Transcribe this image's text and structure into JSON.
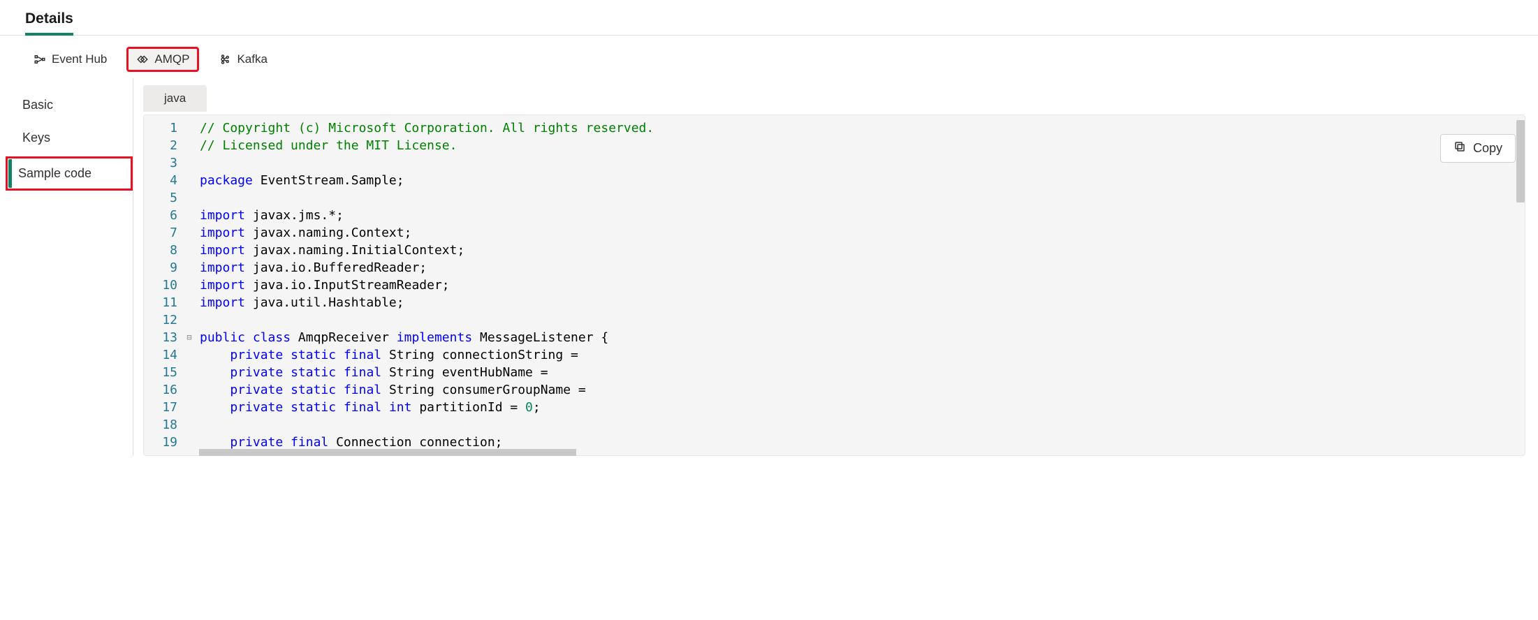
{
  "header": {
    "title": "Details"
  },
  "protocol_tabs": [
    {
      "id": "eventhub",
      "label": "Event Hub",
      "selected": false,
      "highlighted": false
    },
    {
      "id": "amqp",
      "label": "AMQP",
      "selected": true,
      "highlighted": true
    },
    {
      "id": "kafka",
      "label": "Kafka",
      "selected": false,
      "highlighted": false
    }
  ],
  "sidebar": {
    "items": [
      {
        "id": "basic",
        "label": "Basic",
        "active": false,
        "highlighted": false
      },
      {
        "id": "keys",
        "label": "Keys",
        "active": false,
        "highlighted": false
      },
      {
        "id": "sample",
        "label": "Sample code",
        "active": true,
        "highlighted": true
      }
    ]
  },
  "lang_tab": {
    "label": "java"
  },
  "copy_button": {
    "label": "Copy"
  },
  "code": {
    "lines": [
      {
        "n": 1,
        "fold": "",
        "tokens": [
          {
            "t": "// Copyright (c) Microsoft Corporation. All rights reserved.",
            "c": "comment"
          }
        ]
      },
      {
        "n": 2,
        "fold": "",
        "tokens": [
          {
            "t": "// Licensed under the MIT License.",
            "c": "comment"
          }
        ]
      },
      {
        "n": 3,
        "fold": "",
        "tokens": [
          {
            "t": "",
            "c": "ident"
          }
        ]
      },
      {
        "n": 4,
        "fold": "",
        "tokens": [
          {
            "t": "package",
            "c": "keyword"
          },
          {
            "t": " EventStream.Sample;",
            "c": "ident"
          }
        ]
      },
      {
        "n": 5,
        "fold": "",
        "tokens": [
          {
            "t": "",
            "c": "ident"
          }
        ]
      },
      {
        "n": 6,
        "fold": "",
        "tokens": [
          {
            "t": "import",
            "c": "keyword"
          },
          {
            "t": " javax.jms.*;",
            "c": "ident"
          }
        ]
      },
      {
        "n": 7,
        "fold": "",
        "tokens": [
          {
            "t": "import",
            "c": "keyword"
          },
          {
            "t": " javax.naming.Context;",
            "c": "ident"
          }
        ]
      },
      {
        "n": 8,
        "fold": "",
        "tokens": [
          {
            "t": "import",
            "c": "keyword"
          },
          {
            "t": " javax.naming.InitialContext;",
            "c": "ident"
          }
        ]
      },
      {
        "n": 9,
        "fold": "",
        "tokens": [
          {
            "t": "import",
            "c": "keyword"
          },
          {
            "t": " java.io.BufferedReader;",
            "c": "ident"
          }
        ]
      },
      {
        "n": 10,
        "fold": "",
        "tokens": [
          {
            "t": "import",
            "c": "keyword"
          },
          {
            "t": " java.io.InputStreamReader;",
            "c": "ident"
          }
        ]
      },
      {
        "n": 11,
        "fold": "",
        "tokens": [
          {
            "t": "import",
            "c": "keyword"
          },
          {
            "t": " java.util.Hashtable;",
            "c": "ident"
          }
        ]
      },
      {
        "n": 12,
        "fold": "",
        "tokens": [
          {
            "t": "",
            "c": "ident"
          }
        ]
      },
      {
        "n": 13,
        "fold": "⊟",
        "tokens": [
          {
            "t": "public",
            "c": "keyword"
          },
          {
            "t": " ",
            "c": "ident"
          },
          {
            "t": "class",
            "c": "keyword"
          },
          {
            "t": " AmqpReceiver ",
            "c": "ident"
          },
          {
            "t": "implements",
            "c": "keyword"
          },
          {
            "t": " MessageListener {",
            "c": "ident"
          }
        ]
      },
      {
        "n": 14,
        "fold": "",
        "tokens": [
          {
            "t": "    ",
            "c": "ident"
          },
          {
            "t": "private",
            "c": "keyword"
          },
          {
            "t": " ",
            "c": "ident"
          },
          {
            "t": "static",
            "c": "keyword"
          },
          {
            "t": " ",
            "c": "ident"
          },
          {
            "t": "final",
            "c": "keyword"
          },
          {
            "t": " String connectionString =",
            "c": "ident"
          }
        ]
      },
      {
        "n": 15,
        "fold": "",
        "tokens": [
          {
            "t": "    ",
            "c": "ident"
          },
          {
            "t": "private",
            "c": "keyword"
          },
          {
            "t": " ",
            "c": "ident"
          },
          {
            "t": "static",
            "c": "keyword"
          },
          {
            "t": " ",
            "c": "ident"
          },
          {
            "t": "final",
            "c": "keyword"
          },
          {
            "t": " String eventHubName =",
            "c": "ident"
          }
        ]
      },
      {
        "n": 16,
        "fold": "",
        "tokens": [
          {
            "t": "    ",
            "c": "ident"
          },
          {
            "t": "private",
            "c": "keyword"
          },
          {
            "t": " ",
            "c": "ident"
          },
          {
            "t": "static",
            "c": "keyword"
          },
          {
            "t": " ",
            "c": "ident"
          },
          {
            "t": "final",
            "c": "keyword"
          },
          {
            "t": " String consumerGroupName =",
            "c": "ident"
          }
        ]
      },
      {
        "n": 17,
        "fold": "",
        "tokens": [
          {
            "t": "    ",
            "c": "ident"
          },
          {
            "t": "private",
            "c": "keyword"
          },
          {
            "t": " ",
            "c": "ident"
          },
          {
            "t": "static",
            "c": "keyword"
          },
          {
            "t": " ",
            "c": "ident"
          },
          {
            "t": "final",
            "c": "keyword"
          },
          {
            "t": " ",
            "c": "ident"
          },
          {
            "t": "int",
            "c": "keyword"
          },
          {
            "t": " partitionId = ",
            "c": "ident"
          },
          {
            "t": "0",
            "c": "number"
          },
          {
            "t": ";",
            "c": "ident"
          }
        ]
      },
      {
        "n": 18,
        "fold": "",
        "tokens": [
          {
            "t": "",
            "c": "ident"
          }
        ]
      },
      {
        "n": 19,
        "fold": "",
        "tokens": [
          {
            "t": "    ",
            "c": "ident"
          },
          {
            "t": "private",
            "c": "keyword"
          },
          {
            "t": " ",
            "c": "ident"
          },
          {
            "t": "final",
            "c": "keyword"
          },
          {
            "t": " Connection connection;",
            "c": "ident"
          }
        ]
      }
    ]
  }
}
